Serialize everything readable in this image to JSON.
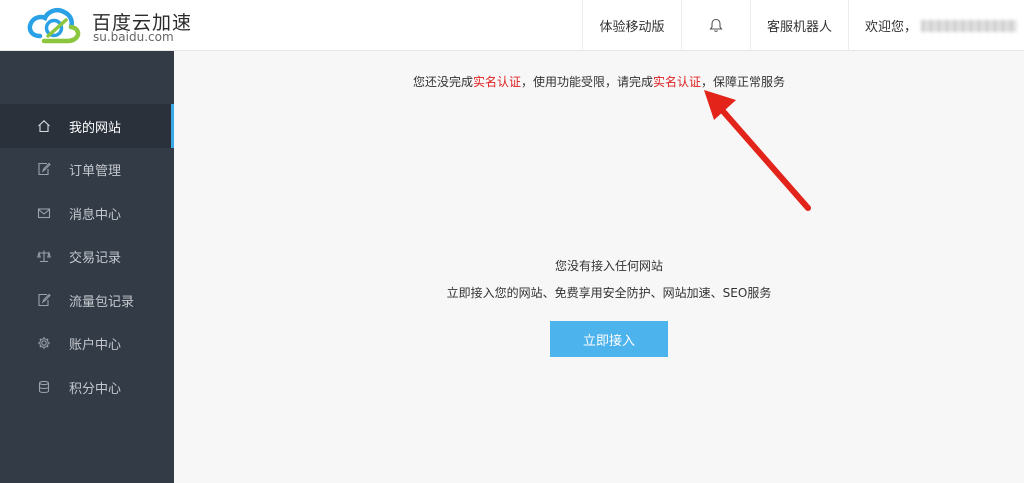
{
  "brand": {
    "title": "百度云加速",
    "subtitle": "su.baidu.com",
    "colors": {
      "blue": "#2aa0e6",
      "green": "#8cc63f"
    }
  },
  "header": {
    "mobile_label": "体验移动版",
    "bell_icon": "bell-icon",
    "robot_label": "客服机器人",
    "welcome_label": "欢迎您，"
  },
  "sidebar": {
    "items": [
      {
        "label": "我的网站",
        "icon": "home-icon",
        "active": true
      },
      {
        "label": "订单管理",
        "icon": "edit-icon"
      },
      {
        "label": "消息中心",
        "icon": "mail-icon"
      },
      {
        "label": "交易记录",
        "icon": "scale-icon"
      },
      {
        "label": "流量包记录",
        "icon": "edit-icon"
      },
      {
        "label": "账户中心",
        "icon": "gear-icon"
      },
      {
        "label": "积分中心",
        "icon": "database-icon"
      }
    ]
  },
  "notice": {
    "part1": "您还没完成",
    "link1": "实名认证",
    "part2": "，使用功能受限，请完成",
    "link2": "实名认证",
    "part3": "，保障正常服务"
  },
  "empty_state": {
    "title": "您没有接入任何网站",
    "description": "立即接入您的网站、免费享用安全防护、网站加速、SEO服务",
    "button_label": "立即接入"
  },
  "colors": {
    "sidebar_bg": "#333b47",
    "accent": "#4db3ec",
    "warning_text": "#e02020",
    "annotation_arrow": "#e3241b"
  }
}
